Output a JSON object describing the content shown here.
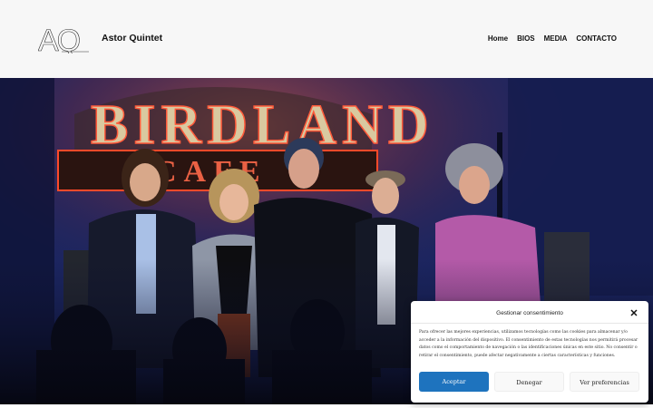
{
  "header": {
    "logo_letters": "AQ",
    "site_title": "Astor Quintet",
    "nav": [
      "Home",
      "BIOS",
      "MEDIA",
      "CONTACTO"
    ]
  },
  "hero": {
    "alt_subject": "five-musicians-on-stage",
    "sign_text": "BIRDLAND",
    "sign_sub": "CAFE",
    "colors": {
      "wall": "#1b2560",
      "neon": "#e8452b",
      "shadow": "#0a0d22"
    }
  },
  "consent": {
    "title": "Gestionar consentimiento",
    "body": "Para ofrecer las mejores experiencias, utilizamos tecnologías como las cookies para almacenar y/o acceder a la información del dispositivo. El consentimiento de estas tecnologías nos permitirá procesar datos como el comportamiento de navegación o las identificaciones únicas en este sitio. No consentir o retirar el consentimiento, puede afectar negativamente a ciertas características y funciones.",
    "accept_label": "Aceptar",
    "deny_label": "Denegar",
    "prefs_label": "Ver preferencias",
    "accent_color": "#1e73be"
  }
}
